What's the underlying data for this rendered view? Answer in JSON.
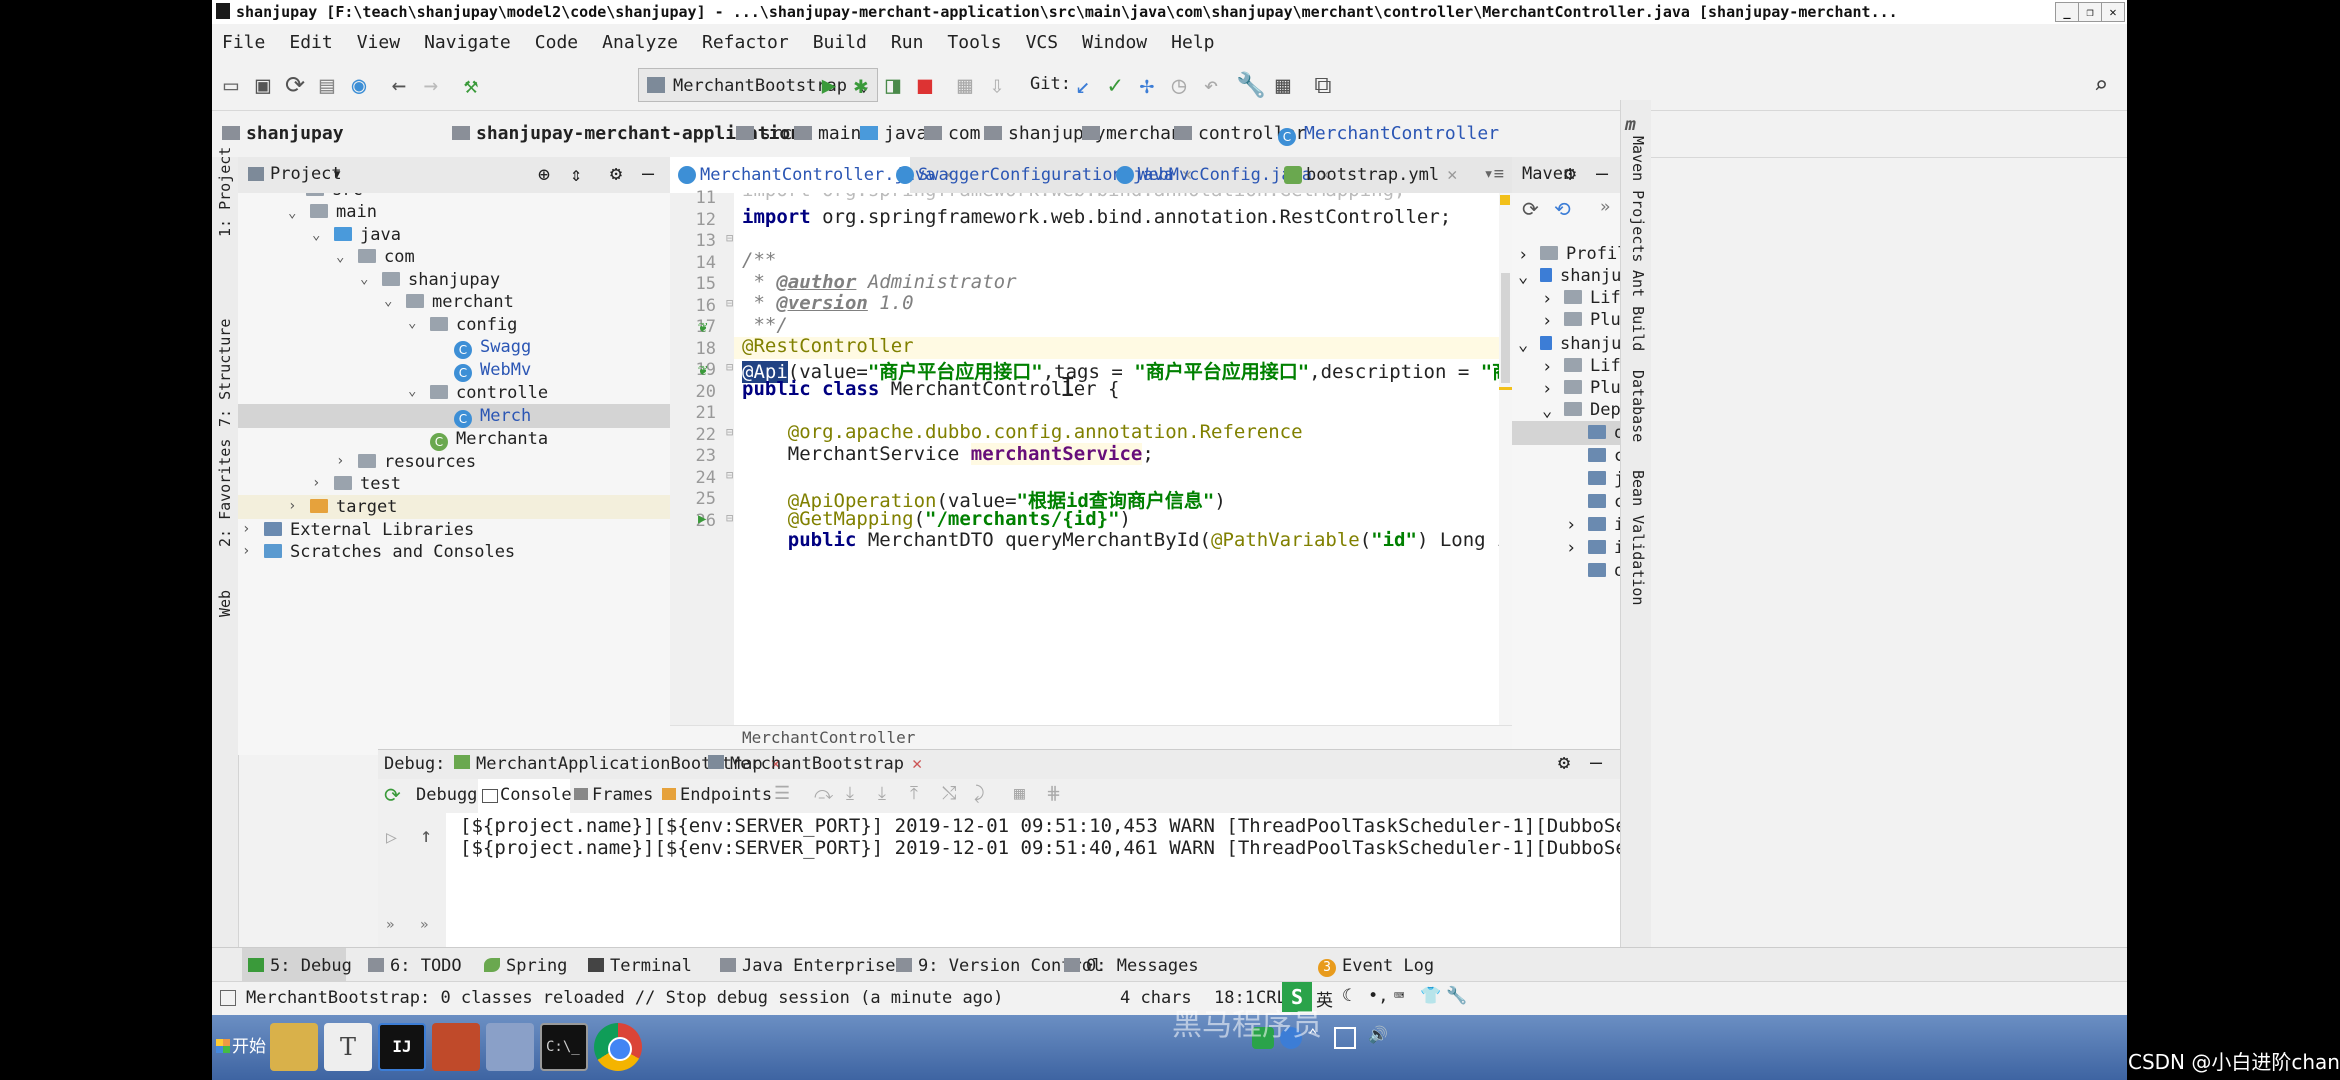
{
  "window": {
    "title": "shanjupay [F:\\teach\\shanjupay\\model2\\code\\shanjupay] - ...\\shanjupay-merchant-application\\src\\main\\java\\com\\shanjupay\\merchant\\controller\\MerchantController.java [shanjupay-merchant..."
  },
  "menu": [
    "File",
    "Edit",
    "View",
    "Navigate",
    "Code",
    "Analyze",
    "Refactor",
    "Build",
    "Run",
    "Tools",
    "VCS",
    "Window",
    "Help"
  ],
  "toolbar": {
    "run_config": "MerchantBootstrap",
    "git_label": "Git:"
  },
  "breadcrumb": [
    "shanjupay",
    "shanjupay-merchant-application",
    "src",
    "main",
    "java",
    "com",
    "shanjupay",
    "merchant",
    "controller",
    "MerchantController"
  ],
  "left_strip": [
    "1: Project",
    "7: Structure",
    "2: Favorites",
    "Web"
  ],
  "project": {
    "header": "Project",
    "tree": [
      "src",
      "main",
      "java",
      "com",
      "shanjupay",
      "merchant",
      "config",
      "Swagg",
      "WebMv",
      "controlle",
      "Merch",
      "Merchanta",
      "resources",
      "test",
      "target",
      "External Libraries",
      "Scratches and Consoles"
    ]
  },
  "editor": {
    "tabs": [
      "MerchantController.java",
      "SwaggerConfiguration.java",
      "WebMvcConfig.java",
      "bootstrap.yml"
    ],
    "line_numbers": [
      "11",
      "12",
      "13",
      "14",
      "15",
      "16",
      "17",
      "18",
      "19",
      "20",
      "21",
      "22",
      "23",
      "24",
      "25",
      "26"
    ],
    "lines": {
      "l10": "import org.springframework.web.bind.annotation.GetMapping;",
      "l11a": "import",
      "l11b": " org.springframework.web.bind.annotation.RestController;",
      "l13": "/**",
      "l14a": " * ",
      "l14b": "@author",
      "l14c": " Administrator",
      "l15a": " * ",
      "l15b": "@version",
      "l15c": " 1.0",
      "l16": " **/",
      "l17": "@RestController",
      "l18a": "@Api",
      "l18b": "(value=",
      "l18c": "\"商户平台应用接口\"",
      "l18d": ",tags = ",
      "l18e": "\"商户平台应用接口\"",
      "l18f": ",description = ",
      "l18g": "\"商户平台应用接口\"",
      "l18h": ")",
      "l19a": "public class",
      "l19b": " MerchantController {",
      "l21a": "    @org.apache.dubbo.config.annotation.",
      "l21b": "Reference",
      "l22a": "    MerchantService ",
      "l22b": "merchantService",
      "l22c": ";",
      "l24a": "    @ApiOperation",
      "l24b": "(value=",
      "l24c": "\"根据id查询商户信息\"",
      "l24d": ")",
      "l25a": "    @GetMapping",
      "l25b": "(",
      "l25c": "\"/merchants/{id}\"",
      "l25d": ")",
      "l26a": "    public",
      "l26b": " MerchantDTO queryMerchantById(",
      "l26c": "@PathVariable",
      "l26d": "(",
      "l26e": "\"id\"",
      "l26f": ") Long id){"
    },
    "footer": "MerchantController"
  },
  "maven": {
    "header": "Maven",
    "items": [
      "Profiles",
      "shanjupay",
      "Lifec",
      "Plugi",
      "shanjupay",
      "Lifec",
      "Plugi",
      "Depen",
      "or",
      "co",
      "ju",
      "co",
      "io",
      "io",
      "or"
    ]
  },
  "right_strip": [
    "Maven Projects",
    "Ant Build",
    "Database",
    "Bean Validation"
  ],
  "debug": {
    "label": "Debug:",
    "sessions": [
      "MerchantApplicationBootstrap",
      "MerchantBootstrap"
    ],
    "tabs": [
      "Debugger",
      "Console",
      "Frames",
      "Endpoints"
    ],
    "console": [
      "[${project.name}][${env:SERVER_PORT}] 2019-12-01 09:51:10,453 WARN [ThreadPoolTaskScheduler-1][DubboServiceMetadataRepository.java:216] - Current applica",
      "[${project.name}][${env:SERVER_PORT}] 2019-12-01 09:51:40,461 WARN [ThreadPoolTaskScheduler-1][DubboServiceMetadataRepository.java:216] - Current applica"
    ]
  },
  "bottom_tabs": [
    "5: Debug",
    "6: TODO",
    "Spring",
    "Terminal",
    "Java Enterprise",
    "9: Version Control",
    "0: Messages"
  ],
  "event_log": {
    "count": "3",
    "label": "Event Log"
  },
  "status": {
    "message": "MerchantBootstrap: 0 classes reloaded // Stop debug session (a minute ago)",
    "chars": "4 chars",
    "position": "18:1",
    "encoding": "CRLF"
  },
  "taskbar": {
    "start": "开始"
  },
  "watermark": {
    "csdn": "CSDN @小白进阶chan",
    "logo": "黑马程序员"
  },
  "colors": {
    "accent": "#3c7dd6",
    "selection": "#214283",
    "string": "#008000",
    "keyword": "#000080"
  }
}
